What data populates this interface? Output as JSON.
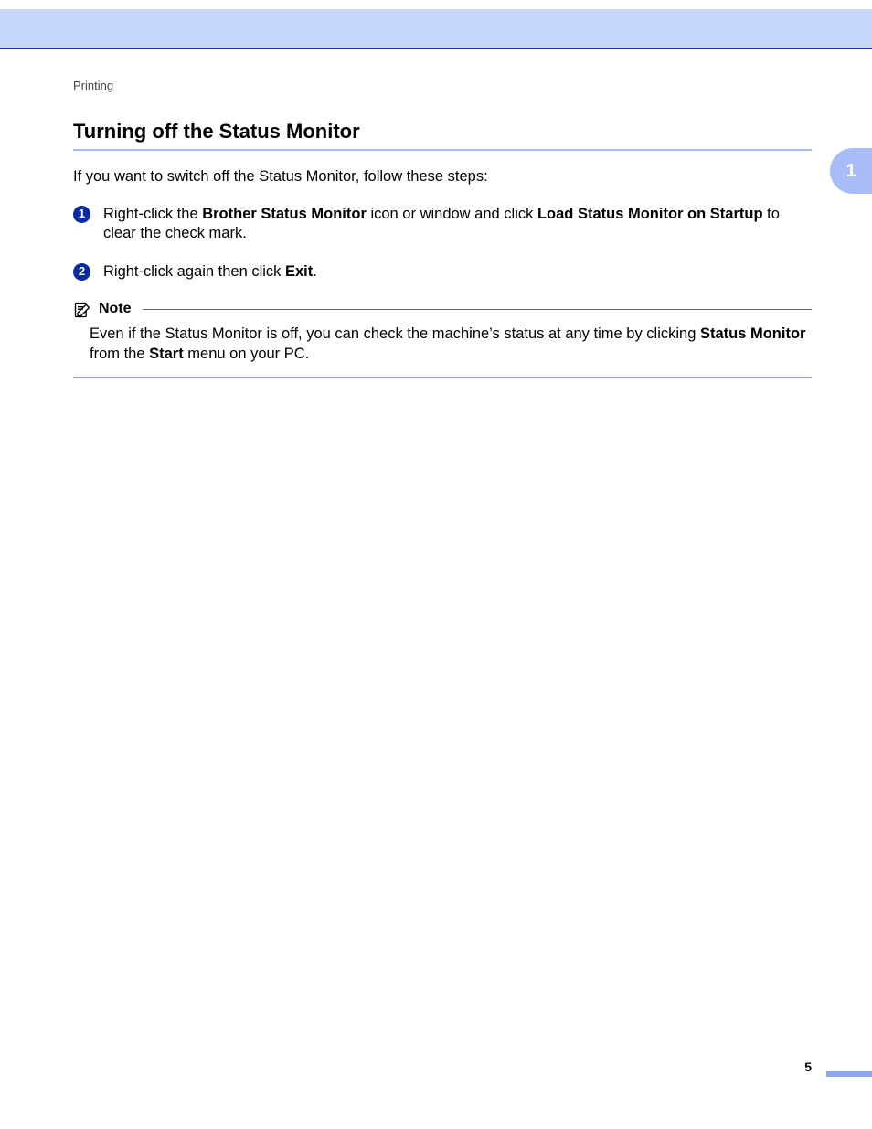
{
  "header": {
    "breadcrumb": "Printing",
    "chapter_tab": "1"
  },
  "main": {
    "heading": "Turning off the Status Monitor",
    "intro": "If you want to switch off the Status Monitor, follow these steps:",
    "steps": [
      {
        "num": "1",
        "pre": "Right-click the ",
        "b1": "Brother Status Monitor",
        "mid": " icon or window and click ",
        "b2": "Load Status Monitor on Startup",
        "post": " to clear the check mark."
      },
      {
        "num": "2",
        "pre": "Right-click again then click ",
        "b1": "Exit",
        "mid": ".",
        "b2": "",
        "post": ""
      }
    ],
    "note": {
      "label": "Note",
      "line1_pre": "Even if the Status Monitor is off, you can check the machine’s status at any time by clicking ",
      "b1": "Status Monitor",
      "line1_mid": " from the ",
      "b2": "Start",
      "line1_post": " menu on your PC."
    }
  },
  "footer": {
    "page_number": "5"
  }
}
